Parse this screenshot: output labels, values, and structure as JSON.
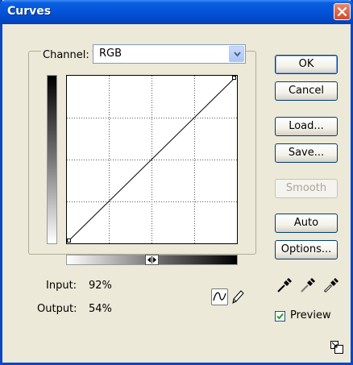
{
  "window": {
    "title": "Curves"
  },
  "channel": {
    "label": "Channel:",
    "value": "RGB"
  },
  "readouts": {
    "input_label": "Input:",
    "input_value": "92%",
    "output_label": "Output:",
    "output_value": "54%"
  },
  "buttons": {
    "ok": "OK",
    "cancel": "Cancel",
    "load": "Load...",
    "save": "Save...",
    "smooth": "Smooth",
    "auto": "Auto",
    "options": "Options..."
  },
  "preview": {
    "label": "Preview",
    "checked": true
  },
  "icons": {
    "close": "close-icon",
    "dropdown": "chevron-down-icon",
    "curve_tool": "curve-tool-icon",
    "pencil_tool": "pencil-icon",
    "black_point": "eyedropper-black-icon",
    "gray_point": "eyedropper-gray-icon",
    "white_point": "eyedropper-white-icon",
    "grid_toggle": "grid-size-icon",
    "gradient_toggle": "gradient-direction-icon"
  },
  "colors": {
    "title_bar": "#0453d8",
    "close_button": "#d24a26",
    "dialog_bg": "#ece9d8"
  }
}
